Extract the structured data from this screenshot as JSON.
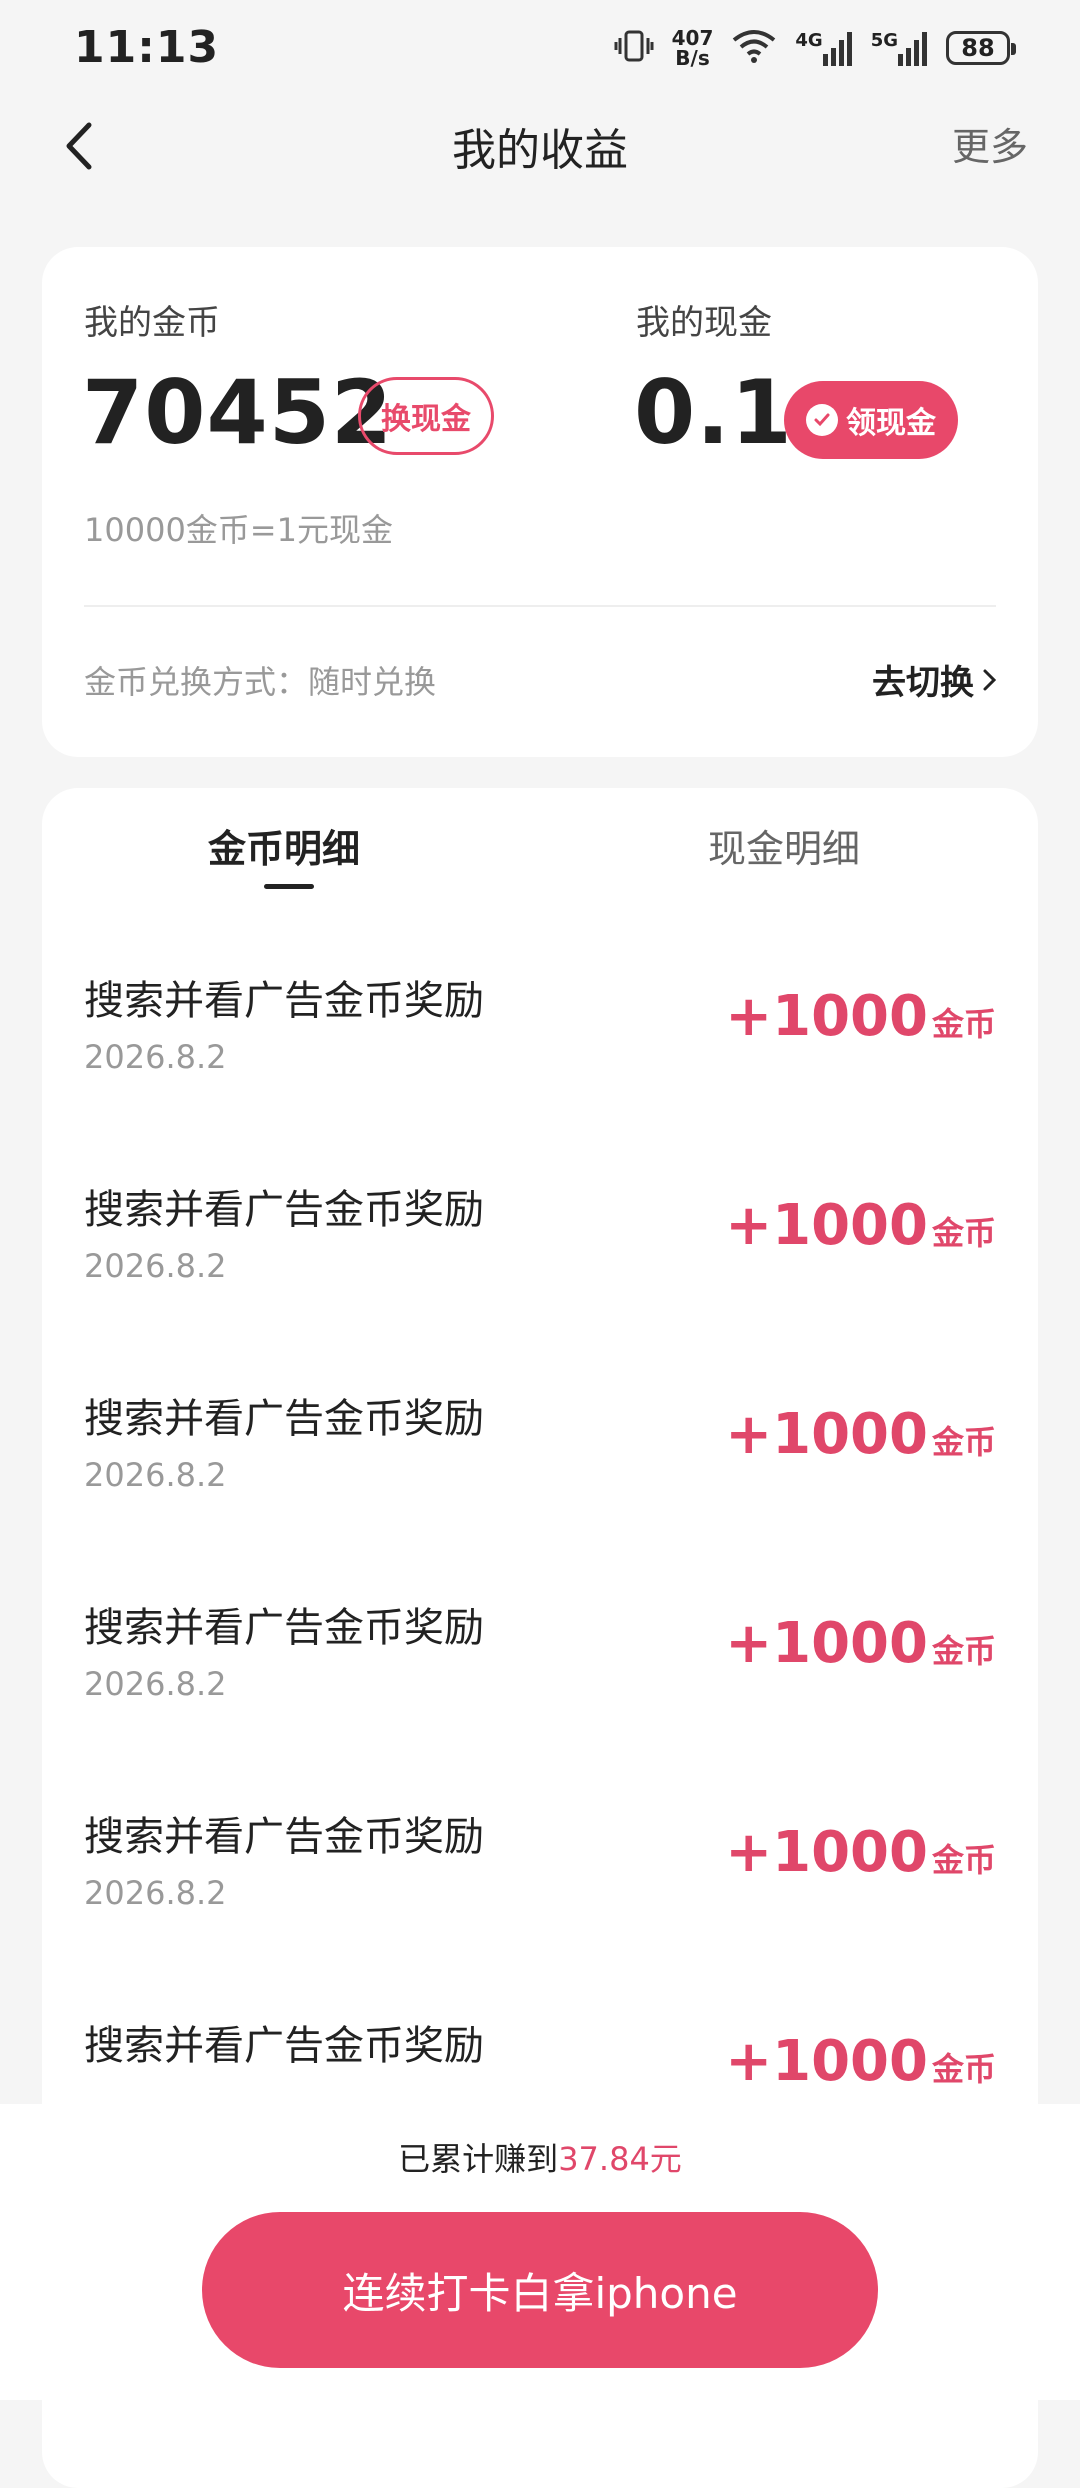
{
  "status_bar": {
    "time": "11:13",
    "net_speed_value": "407",
    "net_speed_unit": "B/s",
    "signal_1_label": "4G",
    "signal_2_label": "5G",
    "battery": "88"
  },
  "header": {
    "title": "我的收益",
    "more_label": "更多"
  },
  "summary": {
    "coins_label": "我的金币",
    "coins_value": "70452",
    "exchange_button": "换现金",
    "cash_label": "我的现金",
    "cash_value": "0.1",
    "claim_button": "领现金",
    "rate_text": "10000金币=1元现金",
    "method_text": "金币兑换方式：随时兑换",
    "switch_link": "去切换"
  },
  "tabs": [
    {
      "label": "金币明细",
      "active": true
    },
    {
      "label": "现金明细",
      "active": false
    }
  ],
  "records": [
    {
      "title": "搜索并看广告金币奖励",
      "date": "2026.8.2",
      "amount": "+1000",
      "unit": "金币"
    },
    {
      "title": "搜索并看广告金币奖励",
      "date": "2026.8.2",
      "amount": "+1000",
      "unit": "金币"
    },
    {
      "title": "搜索并看广告金币奖励",
      "date": "2026.8.2",
      "amount": "+1000",
      "unit": "金币"
    },
    {
      "title": "搜索并看广告金币奖励",
      "date": "2026.8.2",
      "amount": "+1000",
      "unit": "金币"
    },
    {
      "title": "搜索并看广告金币奖励",
      "date": "2026.8.2",
      "amount": "+1000",
      "unit": "金币"
    },
    {
      "title": "搜索并看广告金币奖励",
      "date": "",
      "amount": "+1000",
      "unit": "金币"
    }
  ],
  "bottom": {
    "earned_prefix": "已累计赚到",
    "earned_amount": "37.84元",
    "cta_label": "连续打卡白拿iphone"
  },
  "colors": {
    "accent": "#e8486a",
    "accent_text": "#e0476a",
    "background": "#f5f5f5"
  }
}
